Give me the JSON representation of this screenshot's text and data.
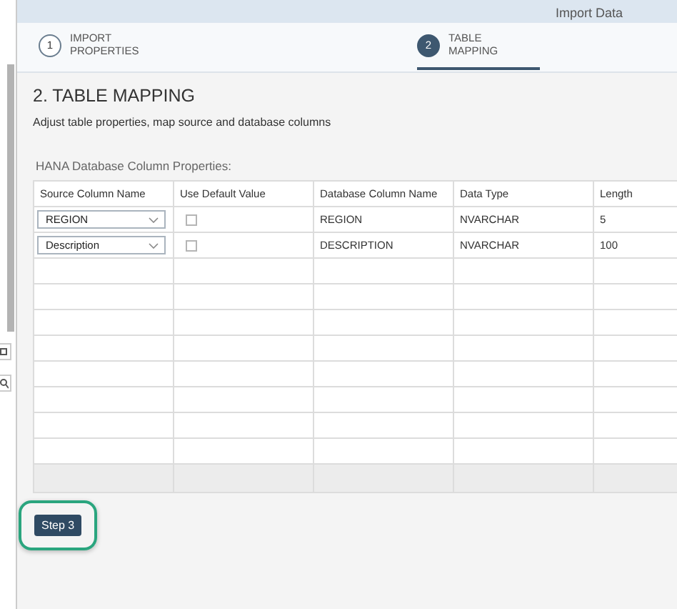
{
  "window": {
    "title": "Import Data"
  },
  "steps": [
    {
      "number": "1",
      "label": "IMPORT PROPERTIES",
      "selected": false
    },
    {
      "number": "2",
      "label": "TABLE MAPPING",
      "selected": true
    }
  ],
  "section": {
    "title": "2. TABLE MAPPING",
    "description": "Adjust table properties, map source and database columns"
  },
  "table": {
    "caption": "HANA Database Column Properties:",
    "columns": [
      "Source Column Name",
      "Use Default Value",
      "Database Column Name",
      "Data Type",
      "Length"
    ],
    "rows": [
      {
        "source": "REGION",
        "use_default": false,
        "db_column": "REGION",
        "data_type": "NVARCHAR",
        "length": "5"
      },
      {
        "source": "Description",
        "use_default": false,
        "db_column": "DESCRIPTION",
        "data_type": "NVARCHAR",
        "length": "100"
      }
    ]
  },
  "next_button": {
    "label": "Step 3",
    "highlighted": true
  }
}
